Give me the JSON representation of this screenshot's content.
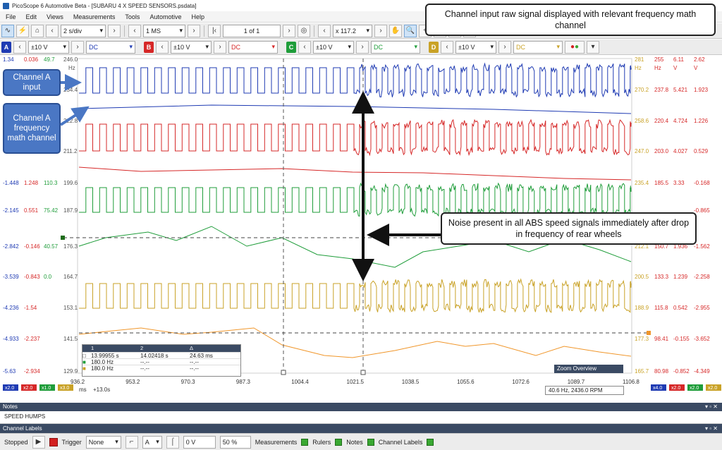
{
  "window": {
    "title": "PicoScope 6 Automotive Beta - [SUBARU 4 X SPEED SENSORS.psdata]"
  },
  "menu": [
    "File",
    "Edit",
    "Views",
    "Measurements",
    "Tools",
    "Automotive",
    "Help"
  ],
  "toolbar": {
    "timebase": "2 s/div",
    "samples": "1 MS",
    "buffer": "1 of 1",
    "zoom": "x 117.2"
  },
  "channels": [
    {
      "letter": "A",
      "range": "±10 V",
      "coupling": "DC",
      "color": "#1f3bb3"
    },
    {
      "letter": "B",
      "range": "±10 V",
      "coupling": "DC",
      "color": "#d62828"
    },
    {
      "letter": "C",
      "range": "±10 V",
      "coupling": "DC",
      "color": "#1f9d3a"
    },
    {
      "letter": "D",
      "range": "±10 V",
      "coupling": "DC",
      "color": "#c9a227"
    }
  ],
  "axes": {
    "left_header": [
      "1.34",
      "0.036",
      "49.7",
      "246.0"
    ],
    "left_units": "Hz",
    "left_rows": [
      [
        "",
        "",
        "",
        "234.4"
      ],
      [
        "",
        "",
        "",
        "222.8"
      ],
      [
        "",
        "",
        "",
        "211.2"
      ],
      [
        "-1.448",
        "1.248",
        "110.3",
        "199.6"
      ],
      [
        "-2.145",
        "0.551",
        "75.42",
        "187.9"
      ],
      [
        "-2.842",
        "-0.146",
        "40.57",
        "176.3"
      ],
      [
        "-3.539",
        "-0.843",
        "0.0",
        "164.7"
      ],
      [
        "-4.236",
        "-1.54",
        "",
        "153.1"
      ],
      [
        "-4.933",
        "-2.237",
        "",
        "141.5"
      ],
      [
        "-5.63",
        "-2.934",
        "",
        "129.9"
      ]
    ],
    "right_header": [
      "281",
      "255",
      "6.11",
      "2.62"
    ],
    "right_units": [
      "Hz",
      "Hz",
      "V",
      "V"
    ],
    "right_rows": [
      [
        "270.2",
        "237.8",
        "5.421",
        "1.923"
      ],
      [
        "258.6",
        "220.4",
        "4.724",
        "1.226"
      ],
      [
        "247.0",
        "203.0",
        "4.027",
        "0.529"
      ],
      [
        "235.4",
        "185.5",
        "3.33",
        "-0.168"
      ],
      [
        "",
        "",
        "",
        "-0.865"
      ],
      [
        "212.1",
        "150.7",
        "1.936",
        "-1.562"
      ],
      [
        "200.5",
        "133.3",
        "1.239",
        "-2.258"
      ],
      [
        "188.9",
        "115.8",
        "0.542",
        "-2.955"
      ],
      [
        "177.3",
        "98.41",
        "-0.155",
        "-3.652"
      ],
      [
        "165.7",
        "80.98",
        "-0.852",
        "-4.349"
      ]
    ],
    "x_ticks": [
      "936.2",
      "953.2",
      "970.3",
      "987.3",
      "1004.4",
      "1021.5",
      "1038.5",
      "1055.6",
      "1072.6",
      "1089.7",
      "1106.8"
    ],
    "x_unit": "ms",
    "x_offset": "+13.0s",
    "scale_badges_left": [
      "x2.0",
      "x2.0",
      "x1.0",
      "x3.0"
    ],
    "scale_badges_right": [
      "x4.0",
      "x2.0",
      "x2.0",
      "x2.0"
    ]
  },
  "measurements_table": {
    "headers": [
      "1",
      "2",
      "Δ"
    ],
    "rows": [
      [
        "13.99955 s",
        "14.02418 s",
        "24.63 ms"
      ],
      [
        "180.0 Hz",
        "--.--",
        "--.--"
      ],
      [
        "180.0 Hz",
        "--.--",
        "--.--"
      ]
    ]
  },
  "zoom_overview": {
    "title": "Zoom Overview"
  },
  "freq_readout": "40.6 Hz, 2436.0 RPM",
  "notes": {
    "title": "Notes",
    "text": "SPEED HUMPS"
  },
  "channel_labels": {
    "title": "Channel Labels"
  },
  "status": {
    "state": "Stopped",
    "trigger_label": "Trigger",
    "trigger_mode": "None",
    "trigger_channel": "A",
    "trigger_level": "0 V",
    "pretrigger": "50 %",
    "measurements_label": "Measurements",
    "rulers_label": "Rulers",
    "notes_label": "Notes",
    "channel_labels_label": "Channel Labels"
  },
  "annotations": {
    "top_callout": "Channel input raw signal displayed with relevant frequency math channel",
    "noise_callout": "Noise present in all ABS speed signals immediately after drop in frequency of rear wheels",
    "channel_a_input": "Channel A input",
    "channel_a_math": "Channel A frequency math channel"
  },
  "colors": {
    "channel_a": "#1f3bb3",
    "channel_b": "#d62828",
    "channel_c": "#1f9d3a",
    "channel_d": "#c9a227",
    "math_orange": "#f0962a",
    "callout_blue": "#4a77c4"
  }
}
